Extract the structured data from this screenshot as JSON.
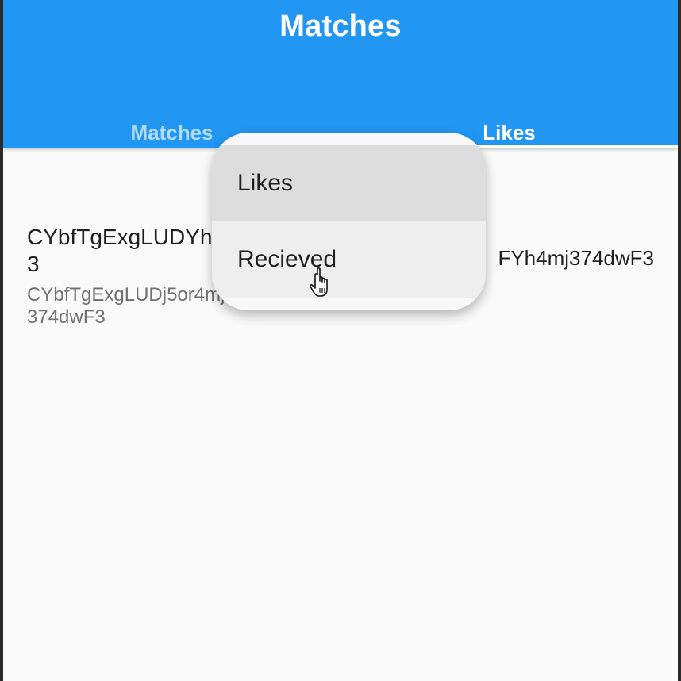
{
  "appbar": {
    "title": "Matches",
    "color": "#2196f3",
    "tabs": [
      {
        "label": "Matches",
        "selected": false
      },
      {
        "label": "Likes",
        "selected": true
      }
    ]
  },
  "content": {
    "left_card": {
      "title": "CYbfTgExgLUDYh4mj374dwF3",
      "subtitle": "CYbfTgExgLUDj5or4mj374dwF3"
    },
    "right_card": {
      "title": "FYh4mj374dwF3"
    }
  },
  "popup_menu": {
    "items": [
      {
        "label": "Likes",
        "highlighted": true
      },
      {
        "label": "Recieved",
        "hovered": true
      }
    ]
  },
  "cursor": {
    "icon": "hand-pointer-icon"
  }
}
